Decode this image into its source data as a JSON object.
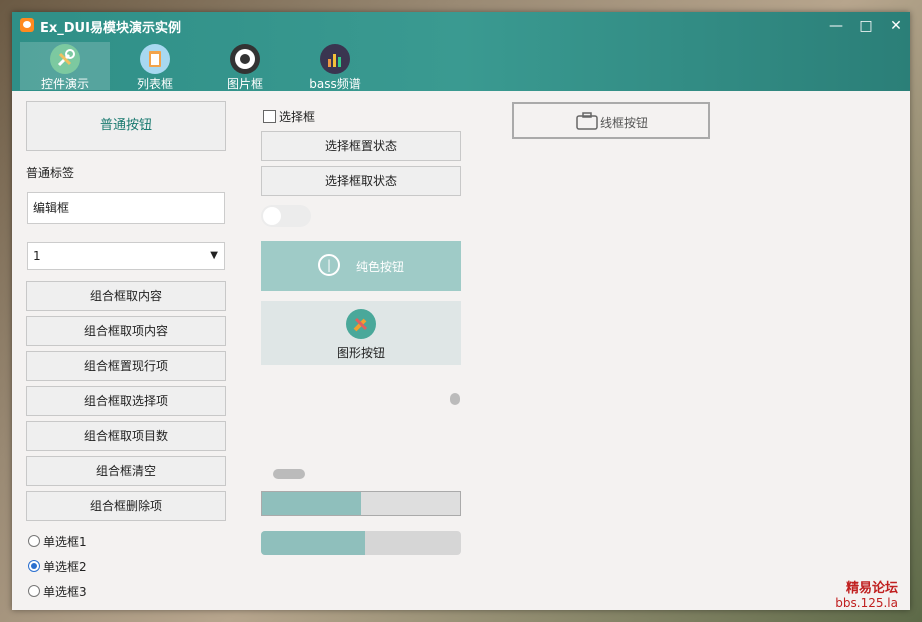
{
  "window": {
    "title": "Ex_DUI易模块演示实例"
  },
  "tabs": [
    {
      "label": "控件演示"
    },
    {
      "label": "列表框"
    },
    {
      "label": "图片框"
    },
    {
      "label": "bass频谱"
    }
  ],
  "left": {
    "normal_button": "普通按钮",
    "normal_label": "普通标签",
    "edit_value": "编辑框",
    "combo_value": "1",
    "buttons": [
      "组合框取内容",
      "组合框取项内容",
      "组合框置现行项",
      "组合框取选择项",
      "组合框取项目数",
      "组合框清空",
      "组合框删除项"
    ],
    "radios": [
      {
        "label": "单选框1",
        "checked": false
      },
      {
        "label": "单选框2",
        "checked": true
      },
      {
        "label": "单选框3",
        "checked": false
      }
    ]
  },
  "middle": {
    "checkbox_label": "选择框",
    "checkbox_checked": false,
    "set_state_button": "选择框置状态",
    "get_state_button": "选择框取状态",
    "toggle_on": false,
    "solid_button": "纯色按钮",
    "graphic_button": "图形按钮",
    "progress1": 0.5,
    "progress2": 0.52
  },
  "right": {
    "outline_button": "线框按钮"
  },
  "watermark": {
    "line1": "精易论坛",
    "line2": "bbs.125.la"
  },
  "colors": {
    "accent": "#2f8f87",
    "solid_button": "#9fcbc7",
    "progress_fill": "#8fbfbc"
  }
}
